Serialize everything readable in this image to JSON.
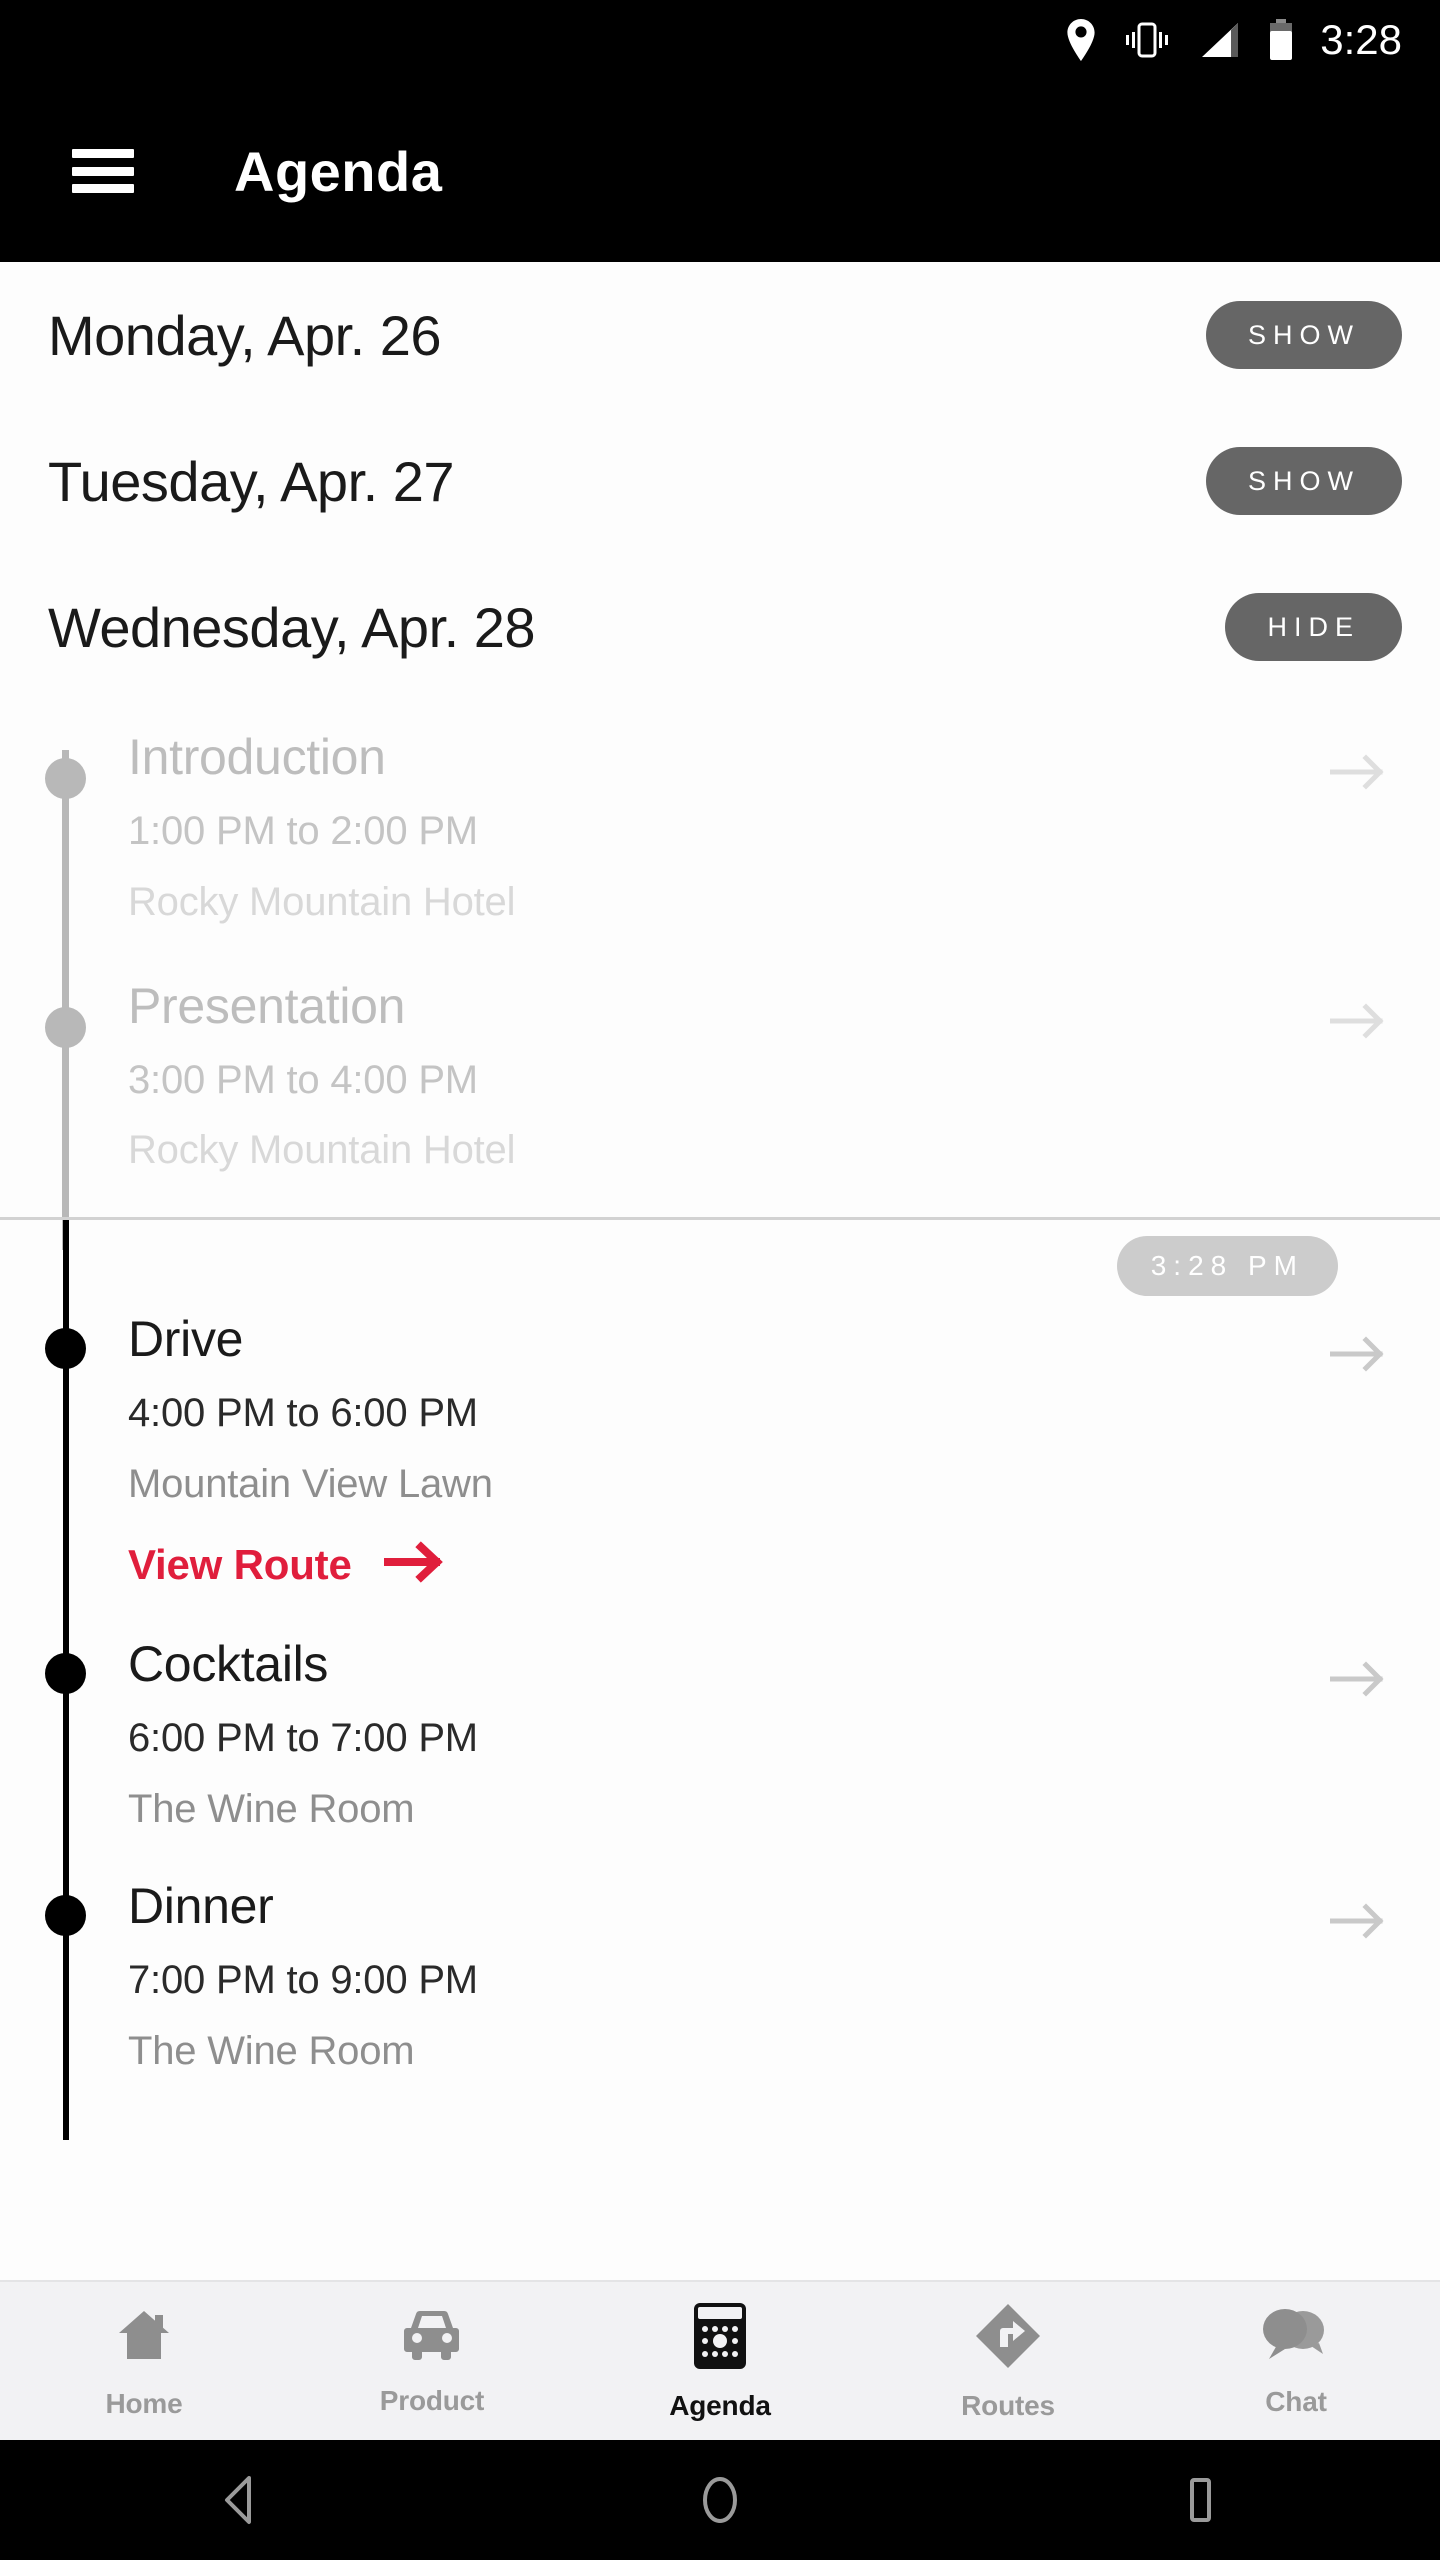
{
  "status_bar": {
    "time": "3:28",
    "icons": [
      "location-pin-icon",
      "vibrate-icon",
      "signal-icon",
      "battery-icon"
    ]
  },
  "app_bar": {
    "menu_icon": "hamburger-menu-icon",
    "title": "Agenda"
  },
  "colors": {
    "accent_red": "#e01e3c",
    "toggle_bg": "#666666",
    "now_badge_bg": "#cccccc",
    "rail_gray": "#b8b8b8",
    "rail_black": "#000000",
    "nav_bg": "#f2f2f4"
  },
  "days": [
    {
      "label": "Monday, Apr. 26",
      "toggle": "SHOW",
      "expanded": false
    },
    {
      "label": "Tuesday, Apr. 27",
      "toggle": "SHOW",
      "expanded": false
    },
    {
      "label": "Wednesday, Apr. 28",
      "toggle": "HIDE",
      "expanded": true
    }
  ],
  "now_marker": {
    "badge": "3:28 PM"
  },
  "events_past": [
    {
      "title": "Introduction",
      "time": "1:00 PM to 2:00 PM",
      "place": "Rocky Mountain Hotel",
      "arrow": "arrow-right-icon"
    },
    {
      "title": "Presentation",
      "time": "3:00 PM to 4:00 PM",
      "place": "Rocky Mountain Hotel",
      "arrow": "arrow-right-icon"
    }
  ],
  "events_upcoming": [
    {
      "title": "Drive",
      "time": "4:00 PM to 6:00 PM",
      "place": "Mountain View Lawn",
      "route_link": "View Route",
      "arrow": "arrow-right-icon"
    },
    {
      "title": "Cocktails",
      "time": "6:00 PM to 7:00 PM",
      "place": "The Wine Room",
      "arrow": "arrow-right-icon"
    },
    {
      "title": "Dinner",
      "time": "7:00 PM to 9:00 PM",
      "place": "The Wine Room",
      "arrow": "arrow-right-icon"
    }
  ],
  "bottom_nav": [
    {
      "label": "Home",
      "icon": "home-icon",
      "active": false
    },
    {
      "label": "Product",
      "icon": "car-icon",
      "active": false
    },
    {
      "label": "Agenda",
      "icon": "calendar-icon",
      "active": true
    },
    {
      "label": "Routes",
      "icon": "route-diamond-icon",
      "active": false
    },
    {
      "label": "Chat",
      "icon": "chat-bubbles-icon",
      "active": false
    }
  ],
  "android_nav": [
    {
      "icon": "back-triangle-icon"
    },
    {
      "icon": "home-circle-icon"
    },
    {
      "icon": "recents-square-icon"
    }
  ]
}
